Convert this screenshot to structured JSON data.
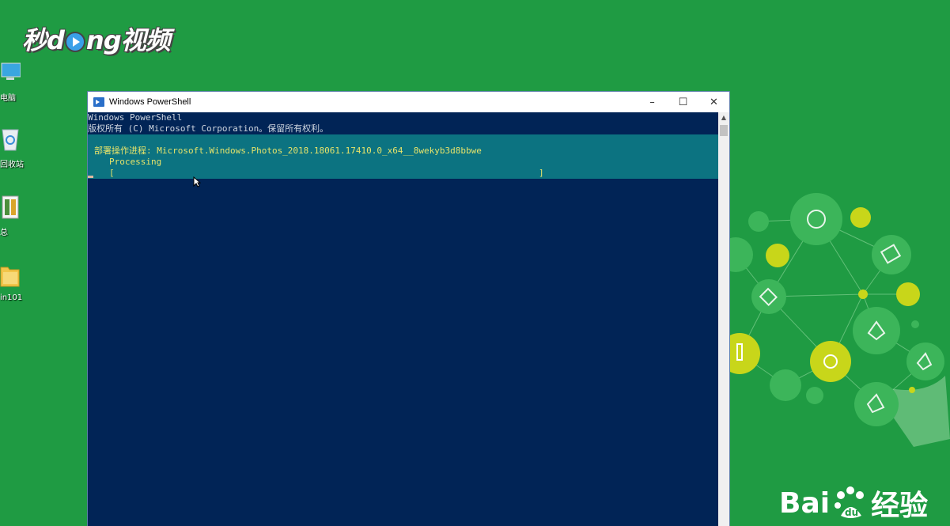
{
  "watermark_top": {
    "prefix": "秒",
    "mid": "ng",
    "suffix": "视频",
    "d": "d"
  },
  "desktop_icons": [
    {
      "label": "电脑"
    },
    {
      "label": "回收站"
    },
    {
      "label": "总"
    },
    {
      "label": "in101"
    }
  ],
  "window": {
    "title": "Windows PowerShell",
    "minimize": "–",
    "maximize": "☐",
    "close": "✕",
    "lines": [
      "Windows PowerShell",
      "版权所有 (C) Microsoft Corporation。保留所有权利。"
    ],
    "progress": {
      "activity": "部署操作进程: Microsoft.Windows.Photos_2018.18061.17410.0_x64__8wekyb3d8bbwe",
      "status": "Processing",
      "bar": "[                                                                                 ]"
    }
  },
  "watermark_baidu": {
    "left": "Bai",
    "right": "经验"
  },
  "colors": {
    "desktop": "#1f9b43",
    "console_bg": "#012456",
    "progress_bg": "#0c7381",
    "progress_text": "#e6e36a"
  },
  "icons": [
    "powershell-icon",
    "computer-icon",
    "recycle-bin-icon",
    "file-icon",
    "folder-icon",
    "mouse-pointer-icon"
  ]
}
